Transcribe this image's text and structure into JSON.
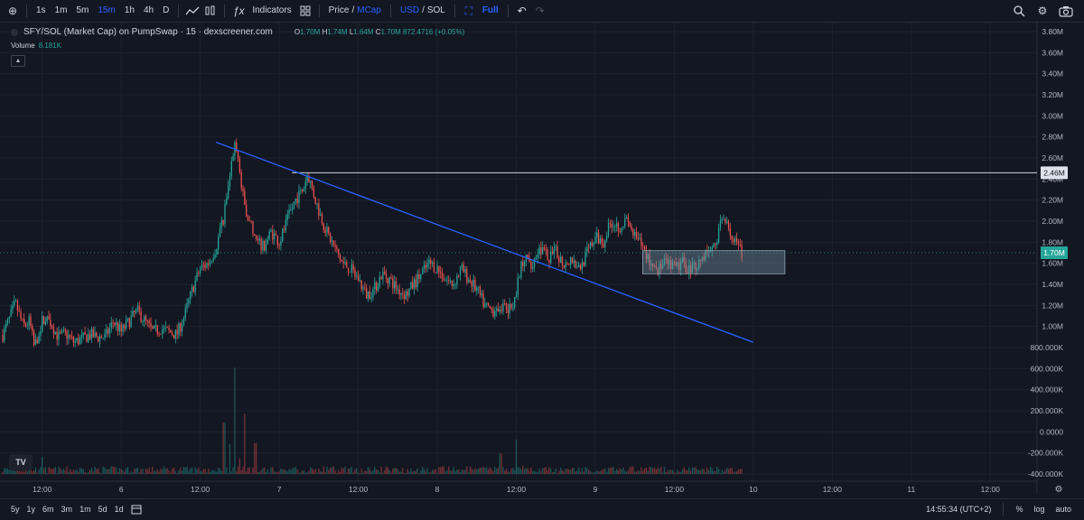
{
  "toolbar": {
    "intervals": [
      "1s",
      "1m",
      "5m",
      "15m",
      "1h",
      "4h",
      "D"
    ],
    "active_interval": "15m",
    "indicators_label": "Indicators",
    "price_label": "Price",
    "mcap_label": "MCap",
    "usd_label": "USD",
    "sol_label": "SOL",
    "full_label": "Full"
  },
  "legend": {
    "title": "SFY/SOL (Market Cap) on PumpSwap · 15 · dexscreener.com",
    "o_label": "O",
    "o": "1.70M",
    "h_label": "H",
    "h": "1.74M",
    "l_label": "L",
    "l": "1.64M",
    "c_label": "C",
    "c": "1.70M",
    "change": "872.4716 (+0.05%)",
    "volume_label": "Volume",
    "volume_value": "8.181K"
  },
  "timeframes": [
    "5y",
    "1y",
    "6m",
    "3m",
    "1m",
    "5d",
    "1d"
  ],
  "status": {
    "time": "14:55:34 (UTC+2)",
    "pct": "%",
    "log": "log",
    "auto": "auto"
  },
  "colors": {
    "up": "#26a69a",
    "down": "#ef5350",
    "trendline": "#2962ff",
    "background": "#131722",
    "box_fill": "#6f8a99"
  },
  "chart_data": {
    "type": "candlestick",
    "title": "SFY/SOL (Market Cap) on PumpSwap · 15 · dexscreener.com",
    "y_ticks": [
      "3.80M",
      "3.60M",
      "3.40M",
      "3.20M",
      "3.00M",
      "2.80M",
      "2.60M",
      "2.40M",
      "2.20M",
      "2.00M",
      "1.80M",
      "1.60M",
      "1.40M",
      "1.20M",
      "1.00M",
      "800.000K",
      "600.000K",
      "400.000K",
      "200.000K",
      "0.0000",
      "-200.000K",
      "-400.000K"
    ],
    "y_tick_values": [
      3.8,
      3.6,
      3.4,
      3.2,
      3.0,
      2.8,
      2.6,
      2.4,
      2.2,
      2.0,
      1.8,
      1.6,
      1.4,
      1.2,
      1.0,
      0.8,
      0.6,
      0.4,
      0.2,
      0.0,
      -0.2,
      -0.4
    ],
    "x_ticks": [
      "12:00",
      "6",
      "12:00",
      "7",
      "12:00",
      "8",
      "12:00",
      "9",
      "12:00",
      "10",
      "12:00",
      "11",
      "12:00"
    ],
    "x_tick_days": [
      5.5,
      6.0,
      6.5,
      7.0,
      7.5,
      8.0,
      8.5,
      9.0,
      9.5,
      10.0,
      10.5,
      11.0,
      11.5
    ],
    "y_range_millions": [
      -0.4,
      3.8
    ],
    "price_path": [
      [
        5.25,
        0.92
      ],
      [
        5.3,
        1.1
      ],
      [
        5.33,
        1.22
      ],
      [
        5.38,
        1.0
      ],
      [
        5.42,
        1.05
      ],
      [
        5.45,
        0.8
      ],
      [
        5.5,
        1.05
      ],
      [
        5.55,
        1.05
      ],
      [
        5.6,
        0.9
      ],
      [
        5.65,
        0.93
      ],
      [
        5.7,
        0.85
      ],
      [
        5.75,
        0.88
      ],
      [
        5.8,
        0.92
      ],
      [
        5.85,
        0.9
      ],
      [
        5.9,
        0.9
      ],
      [
        5.95,
        1.05
      ],
      [
        6.0,
        0.95
      ],
      [
        6.05,
        1.05
      ],
      [
        6.1,
        1.15
      ],
      [
        6.15,
        1.05
      ],
      [
        6.2,
        0.95
      ],
      [
        6.25,
        0.98
      ],
      [
        6.3,
        0.95
      ],
      [
        6.35,
        0.92
      ],
      [
        6.4,
        1.1
      ],
      [
        6.45,
        1.35
      ],
      [
        6.5,
        1.55
      ],
      [
        6.55,
        1.6
      ],
      [
        6.6,
        1.75
      ],
      [
        6.65,
        2.05
      ],
      [
        6.7,
        2.55
      ],
      [
        6.72,
        2.7
      ],
      [
        6.74,
        2.6
      ],
      [
        6.76,
        2.3
      ],
      [
        6.8,
        2.05
      ],
      [
        6.85,
        1.8
      ],
      [
        6.9,
        1.75
      ],
      [
        6.95,
        1.9
      ],
      [
        7.0,
        1.8
      ],
      [
        7.05,
        2.0
      ],
      [
        7.1,
        2.2
      ],
      [
        7.15,
        2.3
      ],
      [
        7.18,
        2.45
      ],
      [
        7.2,
        2.35
      ],
      [
        7.25,
        2.1
      ],
      [
        7.3,
        1.9
      ],
      [
        7.35,
        1.75
      ],
      [
        7.4,
        1.6
      ],
      [
        7.45,
        1.55
      ],
      [
        7.5,
        1.45
      ],
      [
        7.55,
        1.3
      ],
      [
        7.6,
        1.35
      ],
      [
        7.65,
        1.5
      ],
      [
        7.7,
        1.45
      ],
      [
        7.75,
        1.35
      ],
      [
        7.8,
        1.3
      ],
      [
        7.85,
        1.4
      ],
      [
        7.9,
        1.5
      ],
      [
        7.95,
        1.6
      ],
      [
        8.0,
        1.55
      ],
      [
        8.05,
        1.45
      ],
      [
        8.1,
        1.4
      ],
      [
        8.15,
        1.55
      ],
      [
        8.2,
        1.45
      ],
      [
        8.25,
        1.35
      ],
      [
        8.3,
        1.2
      ],
      [
        8.35,
        1.15
      ],
      [
        8.4,
        1.2
      ],
      [
        8.45,
        1.15
      ],
      [
        8.5,
        1.3
      ],
      [
        8.52,
        1.5
      ],
      [
        8.55,
        1.65
      ],
      [
        8.6,
        1.6
      ],
      [
        8.65,
        1.75
      ],
      [
        8.7,
        1.65
      ],
      [
        8.75,
        1.7
      ],
      [
        8.8,
        1.6
      ],
      [
        8.85,
        1.65
      ],
      [
        8.9,
        1.55
      ],
      [
        8.95,
        1.7
      ],
      [
        9.0,
        1.85
      ],
      [
        9.05,
        1.8
      ],
      [
        9.1,
        2.0
      ],
      [
        9.15,
        1.95
      ],
      [
        9.2,
        2.0
      ],
      [
        9.25,
        1.85
      ],
      [
        9.3,
        1.75
      ],
      [
        9.35,
        1.6
      ],
      [
        9.4,
        1.55
      ],
      [
        9.45,
        1.6
      ],
      [
        9.5,
        1.55
      ],
      [
        9.55,
        1.6
      ],
      [
        9.6,
        1.55
      ],
      [
        9.65,
        1.6
      ],
      [
        9.7,
        1.7
      ],
      [
        9.75,
        1.75
      ],
      [
        9.8,
        2.0
      ],
      [
        9.83,
        2.05
      ],
      [
        9.86,
        1.85
      ],
      [
        9.9,
        1.75
      ],
      [
        9.93,
        1.7
      ]
    ],
    "volume_peaks": [
      [
        6.72,
        0.62
      ],
      [
        6.78,
        0.35
      ],
      [
        6.65,
        0.3
      ],
      [
        6.85,
        0.18
      ],
      [
        5.5,
        0.1
      ],
      [
        8.5,
        0.2
      ],
      [
        8.4,
        0.12
      ]
    ],
    "horizontal_line": 2.46,
    "horizontal_line_label": "2.46M",
    "last_price": 1.7,
    "last_price_label": "1.70M",
    "trendline": [
      [
        6.6,
        2.75
      ],
      [
        10.0,
        0.85
      ]
    ],
    "box": {
      "x0": 9.3,
      "x1": 10.2,
      "y0": 1.5,
      "y1": 1.72
    },
    "grid": true
  }
}
